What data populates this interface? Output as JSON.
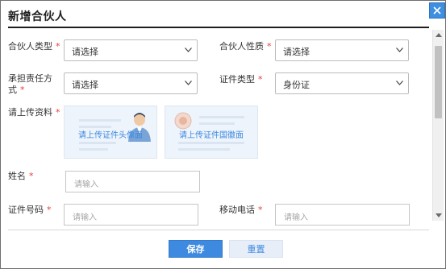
{
  "dialog": {
    "title": "新增合伙人",
    "close_label": "×"
  },
  "form": {
    "required_mark": "*",
    "partner_type": {
      "label": "合伙人类型",
      "value": "请选择"
    },
    "partner_nature": {
      "label": "合伙人性质",
      "value": "请选择"
    },
    "liability_line1": "承担责任方",
    "liability_line2": "式",
    "liability_value": "请选择",
    "id_type": {
      "label": "证件类型",
      "value": "身份证"
    },
    "upload": {
      "label": "请上传资料",
      "front_caption": "请上传证件头像面",
      "back_caption": "请上传证件国徽面"
    },
    "name": {
      "label": "姓名",
      "placeholder": "请输入"
    },
    "id_number": {
      "label": "证件号码",
      "placeholder": "请输入"
    },
    "mobile": {
      "label": "移动电话",
      "placeholder": "请输入"
    }
  },
  "footer": {
    "save_label": "保存",
    "reset_label": "重置"
  },
  "colors": {
    "accent": "#3d8ae0",
    "required": "#e53a3a",
    "title_line": "#1e1e1e"
  }
}
